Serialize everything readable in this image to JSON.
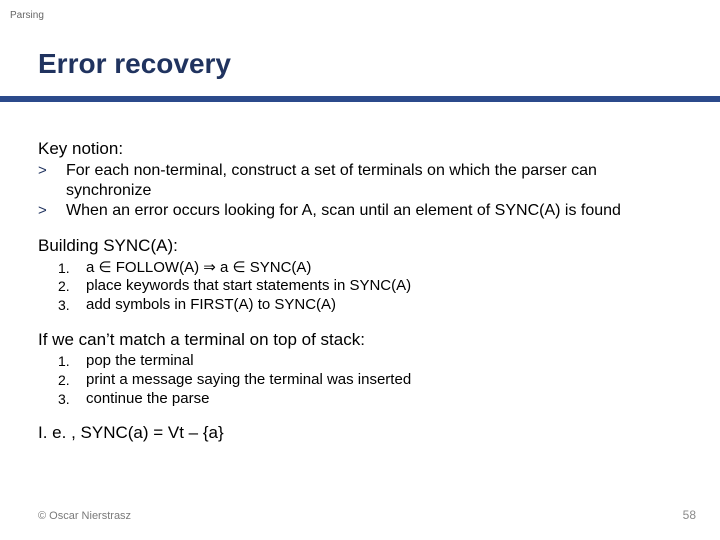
{
  "topic": "Parsing",
  "title": "Error recovery",
  "key": {
    "lead": "Key notion:",
    "items": [
      "For each non-terminal, construct a set of terminals on which the parser can synchronize",
      "When an error occurs looking for A, scan until an element of SYNC(A) is found"
    ]
  },
  "build": {
    "lead": "Building SYNC(A):",
    "items": [
      "a ∈ FOLLOW(A) ⇒ a ∈ SYNC(A)",
      "place keywords that start statements in SYNC(A)",
      "add symbols in FIRST(A) to SYNC(A)"
    ]
  },
  "nomatch": {
    "lead": "If we can’t match a terminal on top of stack:",
    "items": [
      "pop the terminal",
      "print a message saying the terminal was inserted",
      "continue the parse"
    ]
  },
  "ie": "I. e. , SYNC(a) = Vt – {a}",
  "footer": {
    "left": "© Oscar Nierstrasz",
    "right": "58"
  },
  "nums": {
    "n1": "1.",
    "n2": "2.",
    "n3": "3."
  },
  "marks": {
    "gt": ">"
  }
}
